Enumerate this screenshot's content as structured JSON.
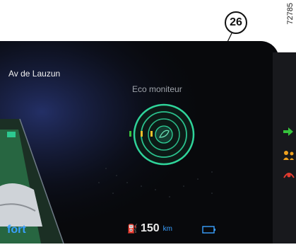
{
  "callout": {
    "number": "26"
  },
  "image_id": "72785",
  "dashboard": {
    "street_name": "Av de Lauzun",
    "eco_monitor_label": "Eco moniteur",
    "drive_mode_partial": "fort",
    "range_value": "150",
    "range_unit": "km",
    "fuel_icon": "fuel-pump-icon",
    "battery_icon": "battery-icon",
    "accent_color": "#3aa0ff",
    "eco_ring_color": "#2fd49a"
  },
  "indicators": [
    {
      "name": "arrow-right-indicator-icon",
      "color": "#36c23c"
    },
    {
      "name": "driver-assist-indicator-icon",
      "color": "#f0a21e"
    },
    {
      "name": "warning-indicator-icon",
      "color": "#e23b2f"
    }
  ]
}
